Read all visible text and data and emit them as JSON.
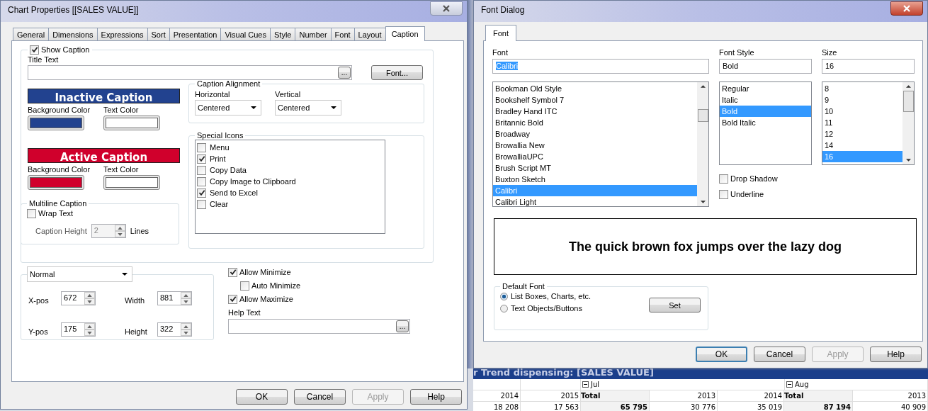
{
  "chart_properties": {
    "title": "Chart Properties [[SALES VALUE]]",
    "tabs": [
      {
        "label": "General",
        "selected": false
      },
      {
        "label": "Dimensions",
        "selected": false
      },
      {
        "label": "Expressions",
        "selected": false
      },
      {
        "label": "Sort",
        "selected": false
      },
      {
        "label": "Presentation",
        "selected": false
      },
      {
        "label": "Visual Cues",
        "selected": false
      },
      {
        "label": "Style",
        "selected": false
      },
      {
        "label": "Number",
        "selected": false
      },
      {
        "label": "Font",
        "selected": false
      },
      {
        "label": "Layout",
        "selected": false
      },
      {
        "label": "Caption",
        "selected": true
      }
    ],
    "show_caption": {
      "label": "Show Caption",
      "checked": true
    },
    "title_text": {
      "label": "Title Text",
      "browse_button": "..."
    },
    "font_button": "Font...",
    "captions": [
      {
        "label": "Inactive Caption",
        "color": "#22428f",
        "background_label": "Background Color",
        "text_label": "Text Color"
      },
      {
        "label": "Active Caption",
        "color": "#d0002c",
        "background_label": "Background Color",
        "text_label": "Text Color"
      }
    ],
    "multiline": {
      "title": "Multiline Caption",
      "wrap_text": {
        "label": "Wrap Text",
        "checked": false
      },
      "caption_height": {
        "label": "Caption Height",
        "value": "2",
        "disabled": true
      },
      "unit": "Lines"
    },
    "alignment": {
      "title": "Caption Alignment",
      "selects": [
        {
          "label": "Horizontal",
          "value": "Centered"
        },
        {
          "label": "Vertical",
          "value": "Centered"
        }
      ]
    },
    "special_icons": {
      "title": "Special Icons",
      "items": [
        {
          "label": "Menu",
          "checked": false
        },
        {
          "label": "Print",
          "checked": true
        },
        {
          "label": "Copy Data",
          "checked": false
        },
        {
          "label": "Copy Image to Clipboard",
          "checked": false
        },
        {
          "label": "Send to Excel",
          "checked": true
        },
        {
          "label": "Clear",
          "checked": false
        }
      ]
    },
    "position": {
      "mode": "Normal",
      "fields": [
        {
          "label": "X-pos",
          "value": "672"
        },
        {
          "label": "Width",
          "value": "881"
        },
        {
          "label": "Y-pos",
          "value": "175"
        },
        {
          "label": "Height",
          "value": "322"
        }
      ]
    },
    "window_options": [
      {
        "label": "Allow Minimize",
        "checked": true,
        "children": [
          {
            "label": "Auto Minimize",
            "checked": false
          }
        ]
      },
      {
        "label": "Allow Maximize",
        "checked": true
      }
    ],
    "help_text": {
      "label": "Help Text",
      "browse_button": "..."
    },
    "buttons": [
      {
        "label": "OK",
        "disabled": false
      },
      {
        "label": "Cancel",
        "disabled": false
      },
      {
        "label": "Apply",
        "disabled": true
      },
      {
        "label": "Help",
        "disabled": false
      }
    ]
  },
  "font_dialog": {
    "title": "Font Dialog",
    "tabs": [
      {
        "label": "Font",
        "selected": true
      }
    ],
    "font": {
      "label": "Font",
      "value": "Calibri",
      "text_selected": true,
      "items": [
        {
          "label": "Bookman Old Style",
          "selected": false
        },
        {
          "label": "Bookshelf Symbol 7",
          "selected": false
        },
        {
          "label": "Bradley Hand ITC",
          "selected": false
        },
        {
          "label": "Britannic Bold",
          "selected": false
        },
        {
          "label": "Broadway",
          "selected": false
        },
        {
          "label": "Browallia New",
          "selected": false
        },
        {
          "label": "BrowalliaUPC",
          "selected": false
        },
        {
          "label": "Brush Script MT",
          "selected": false
        },
        {
          "label": "Buxton Sketch",
          "selected": false
        },
        {
          "label": "Calibri",
          "selected": true
        },
        {
          "label": "Calibri Light",
          "selected": false
        }
      ]
    },
    "style": {
      "label": "Font Style",
      "value": "Bold",
      "items": [
        {
          "label": "Regular",
          "selected": false
        },
        {
          "label": "Italic",
          "selected": false
        },
        {
          "label": "Bold",
          "selected": true
        },
        {
          "label": "Bold Italic",
          "selected": false
        }
      ]
    },
    "size": {
      "label": "Size",
      "value": "16",
      "items": [
        {
          "label": "8",
          "selected": false
        },
        {
          "label": "9",
          "selected": false
        },
        {
          "label": "10",
          "selected": false
        },
        {
          "label": "11",
          "selected": false
        },
        {
          "label": "12",
          "selected": false
        },
        {
          "label": "14",
          "selected": false
        },
        {
          "label": "16",
          "selected": true
        }
      ]
    },
    "effects": [
      {
        "label": "Drop Shadow",
        "checked": false
      },
      {
        "label": "Underline",
        "checked": false
      }
    ],
    "preview": "The quick brown fox jumps over the lazy dog",
    "default_font": {
      "title": "Default Font",
      "options": [
        {
          "label": "List Boxes, Charts, etc.",
          "selected": true
        },
        {
          "label": "Text Objects/Buttons",
          "selected": false
        }
      ],
      "set_button": "Set"
    },
    "buttons": [
      {
        "label": "OK",
        "disabled": false,
        "focused": true
      },
      {
        "label": "Cancel",
        "disabled": false,
        "focused": false
      },
      {
        "label": "Apply",
        "disabled": true,
        "focused": false
      },
      {
        "label": "Help",
        "disabled": false,
        "focused": false
      }
    ]
  },
  "pivot_table": {
    "title": "r Trend dispensing: [SALES VALUE]",
    "month_groups": [
      {
        "label": "Jul",
        "expanded": true
      },
      {
        "label": "Aug",
        "expanded": true
      }
    ],
    "header_cells": [
      {
        "text": "2014",
        "total": false
      },
      {
        "text": "2015",
        "total": false
      },
      {
        "text": "Total",
        "total": true
      },
      {
        "text": "2013",
        "total": false
      },
      {
        "text": "2014",
        "total": false
      },
      {
        "text": "Total",
        "total": true
      },
      {
        "text": "2013",
        "total": false
      }
    ],
    "data_cells": [
      {
        "text": "18 208",
        "total": false
      },
      {
        "text": "17 563",
        "total": false
      },
      {
        "text": "65 795",
        "total": true
      },
      {
        "text": "30 776",
        "total": false
      },
      {
        "text": "35 019",
        "total": false
      },
      {
        "text": "87 194",
        "total": true
      },
      {
        "text": "40 909",
        "total": false
      }
    ]
  }
}
